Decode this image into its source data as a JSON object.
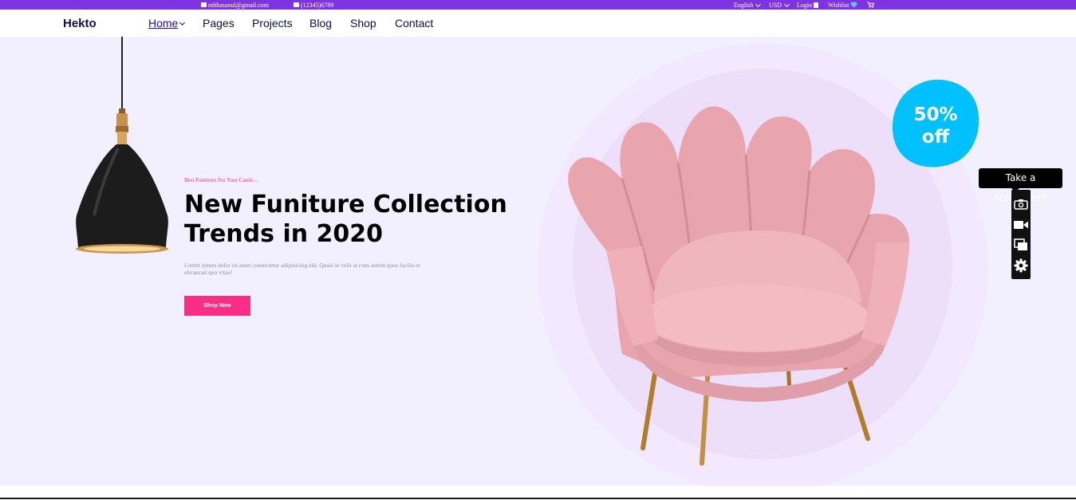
{
  "topbar": {
    "email": "mhhasanul@gmail.com",
    "phone": "(12345)6789",
    "language": "English",
    "currency": "USD",
    "login": "Login",
    "wishlist": "Wishlist",
    "email_icon": "mail-icon",
    "phone_icon": "phone-icon",
    "user_icon": "user-icon",
    "heart_icon": "heart-icon",
    "cart_icon": "cart-icon"
  },
  "navbar": {
    "logo": "Hekto",
    "links": [
      "Home",
      "Pages",
      "Projects",
      "Blog",
      "Shop",
      "Contact"
    ],
    "active": "Home"
  },
  "hero": {
    "tagline": "Best Furniture For Your Castle....",
    "headline": "New Funiture Collection Trends in 2020",
    "description": "Lorem ipsum dolor sit amet consectetur adipisicing elit. Quasi in velit at cum autem quos facilis et obcaecati quo vitae!",
    "button": "Shop Now",
    "badge_line1": "50%",
    "badge_line2": "off"
  },
  "overlay": {
    "tooltip": "Take a screenshot",
    "tools": [
      "camera-icon",
      "video-icon",
      "windows-icon",
      "gear-icon"
    ]
  },
  "colors": {
    "topbar": "#7e33e0",
    "brand_pink": "#fb2e86",
    "navy": "#0d0e43",
    "hero_bg": "#f2f0ff",
    "badge": "#00c1fe"
  }
}
